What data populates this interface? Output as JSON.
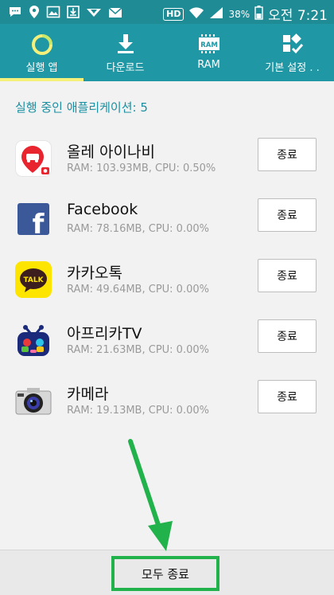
{
  "status_bar": {
    "hd_label": "HD",
    "battery_percent": "38%",
    "time": "오전 7:21",
    "icons": [
      "chat-icon",
      "location-icon",
      "image-icon",
      "download-icon",
      "vpn-icon",
      "mail-icon",
      "wifi-icon",
      "signal-icon",
      "battery-icon"
    ]
  },
  "tabs": [
    {
      "label": "실행 앱",
      "icon": "running-apps-icon",
      "active": true
    },
    {
      "label": "다운로드",
      "icon": "download-icon",
      "active": false
    },
    {
      "label": "RAM",
      "icon": "ram-chip-icon",
      "icon_text": "RAM",
      "active": false
    },
    {
      "label": "기본 설정 . .",
      "icon": "default-settings-icon",
      "active": false
    }
  ],
  "running_count_text": "실행 중인 애플리케이션: 5",
  "apps": [
    {
      "name": "올레 아이나비",
      "stats": "RAM: 103.93MB, CPU: 0.50%",
      "end_label": "종료",
      "icon": "olleh-inavi-icon"
    },
    {
      "name": "Facebook",
      "stats": "RAM: 78.16MB, CPU: 0.00%",
      "end_label": "종료",
      "icon": "facebook-icon",
      "icon_text": "f"
    },
    {
      "name": "카카오톡",
      "stats": "RAM: 49.64MB, CPU: 0.00%",
      "end_label": "종료",
      "icon": "kakaotalk-icon",
      "icon_text": "TALK"
    },
    {
      "name": "아프리카TV",
      "stats": "RAM: 21.63MB, CPU: 0.00%",
      "end_label": "종료",
      "icon": "afreecatv-icon"
    },
    {
      "name": "카메라",
      "stats": "RAM: 19.13MB, CPU: 0.00%",
      "end_label": "종료",
      "icon": "camera-icon"
    }
  ],
  "end_all_label": "모두 종료",
  "colors": {
    "status_bar": "#1f8b95",
    "tab_bar": "#1f97a4",
    "tab_indicator": "#f4f07a",
    "count_text": "#1d8fa0",
    "highlight": "#22b24c"
  }
}
